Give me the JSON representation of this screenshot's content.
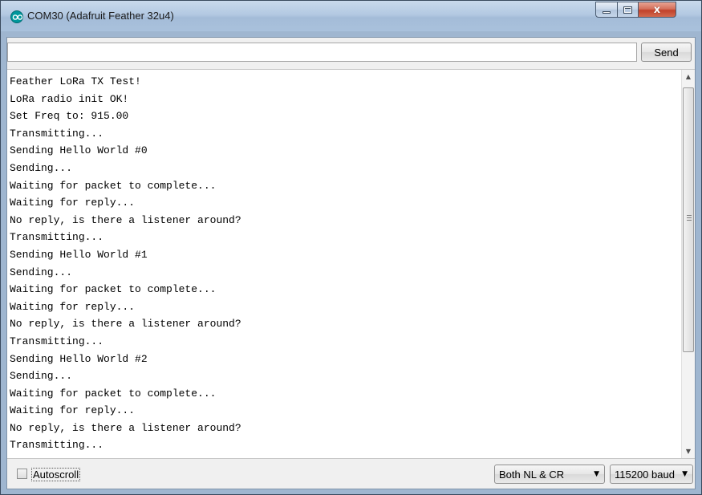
{
  "window": {
    "title": "COM30 (Adafruit Feather 32u4)",
    "icon": "arduino-icon",
    "controls": {
      "minimize": "minimize",
      "maximize": "maximize",
      "close": "x"
    }
  },
  "input": {
    "value": "",
    "send_label": "Send"
  },
  "output": {
    "lines": [
      "Feather LoRa TX Test!",
      "LoRa radio init OK!",
      "Set Freq to: 915.00",
      "Transmitting...",
      "Sending Hello World #0",
      "Sending...",
      "Waiting for packet to complete...",
      "Waiting for reply...",
      "No reply, is there a listener around?",
      "Transmitting...",
      "Sending Hello World #1",
      "Sending...",
      "Waiting for packet to complete...",
      "Waiting for reply...",
      "No reply, is there a listener around?",
      "Transmitting...",
      "Sending Hello World #2",
      "Sending...",
      "Waiting for packet to complete...",
      "Waiting for reply...",
      "No reply, is there a listener around?",
      "Transmitting..."
    ]
  },
  "footer": {
    "autoscroll_label": "Autoscroll",
    "autoscroll_checked": false,
    "line_ending": "Both NL & CR",
    "baud_rate": "115200 baud"
  }
}
